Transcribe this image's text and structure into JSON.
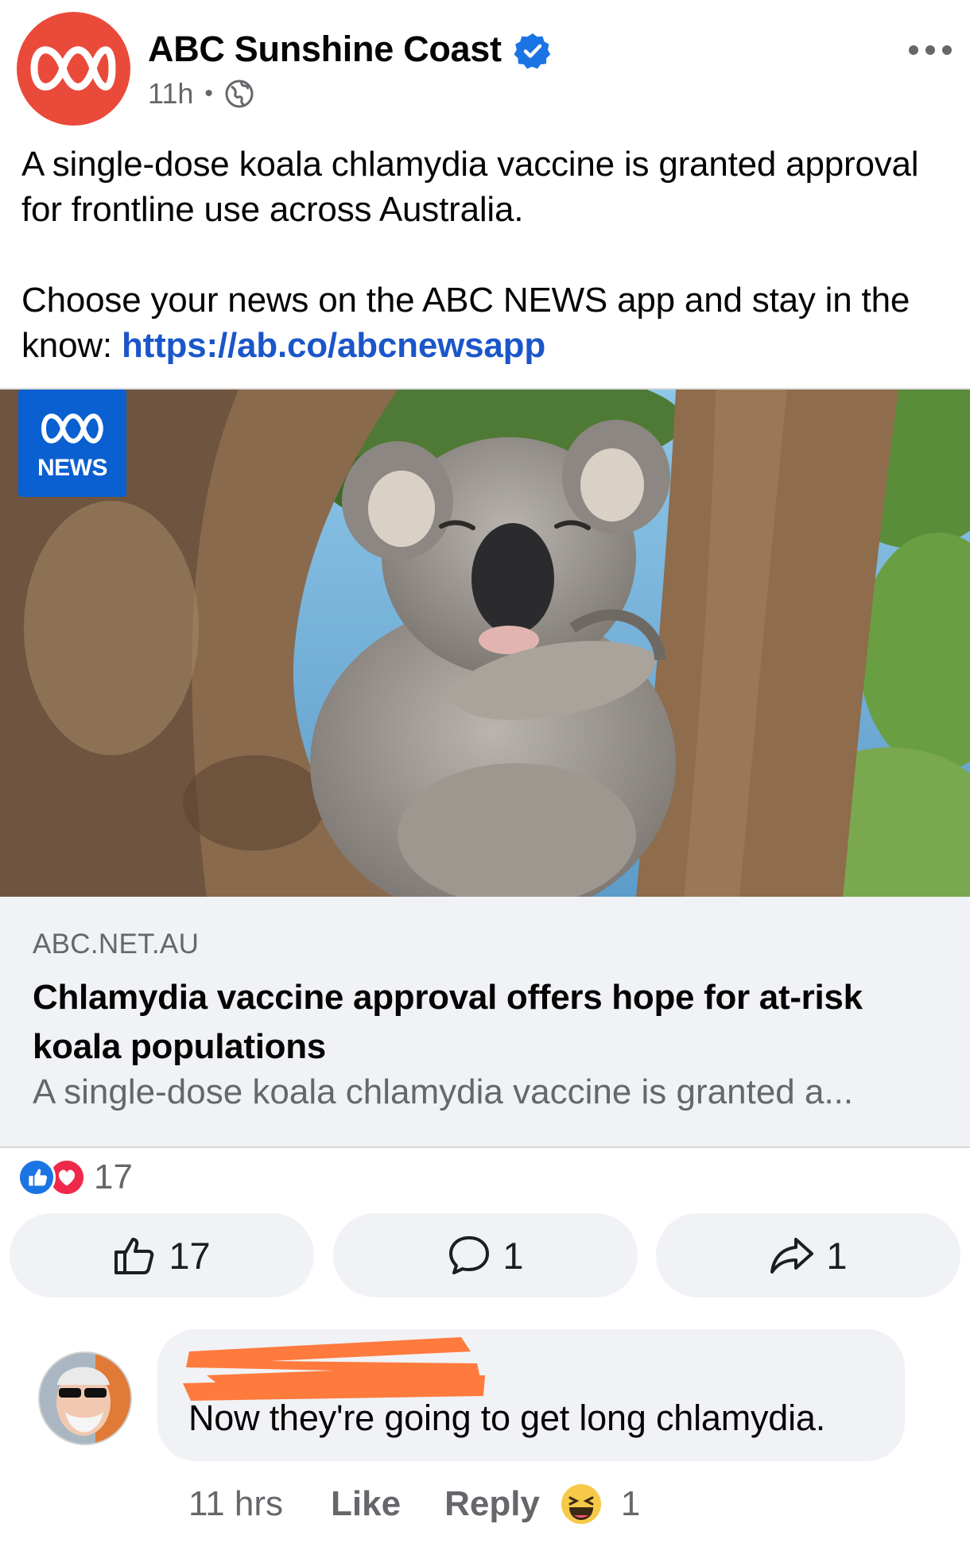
{
  "header": {
    "page_name": "ABC Sunshine Coast",
    "timestamp": "11h",
    "separator": "•"
  },
  "post": {
    "paragraph1": "A single-dose koala chlamydia vaccine is granted approval for frontline use across Australia.",
    "paragraph2_prefix": "Choose your news on the ABC NEWS app and stay in the know: ",
    "link_text": "https://ab.co/abcnewsapp"
  },
  "image": {
    "badge_label": "NEWS"
  },
  "preview": {
    "domain": "ABC.NET.AU",
    "headline": "Chlamydia vaccine approval offers hope for at-risk koala populations",
    "description": "A single-dose koala chlamydia vaccine is granted a..."
  },
  "reactions": {
    "count": "17"
  },
  "actions": {
    "like_count": "17",
    "comment_count": "1",
    "share_count": "1"
  },
  "comment": {
    "text": "Now they're going to get long chlamydia.",
    "time": "11 hrs",
    "like_label": "Like",
    "reply_label": "Reply",
    "reaction_count": "1"
  },
  "colors": {
    "link": "#1b56c9",
    "abc_red": "#ea4a3a",
    "news_blue": "#0a5fd1",
    "like_blue": "#1b74e4",
    "love_red": "#f0284a",
    "redaction_orange": "#ff7a3d"
  },
  "icons": {
    "verified": "verified-badge-icon",
    "audience": "globe-icon",
    "menu": "more-horizontal-icon",
    "like": "thumbs-up-icon",
    "comment": "speech-bubble-icon",
    "share": "share-arrow-icon",
    "haha": "laughing-face-icon"
  }
}
